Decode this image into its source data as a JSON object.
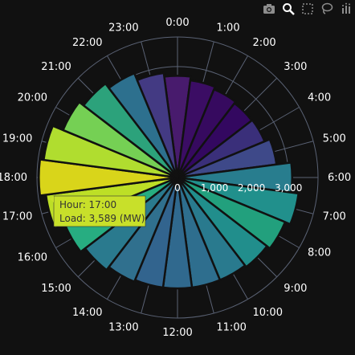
{
  "modebar": {
    "icons": [
      "camera-icon",
      "zoom-icon",
      "select-box-icon",
      "lasso-icon",
      "plotly-logo-icon"
    ]
  },
  "colors": {
    "background": "#111111",
    "grid": "#5a6274",
    "bar_edge": "#111111",
    "tooltip_bg": "#c8e02a"
  },
  "chart_data": {
    "type": "barpolar",
    "direction": "clockwise",
    "rotation_origin": "top",
    "categories": [
      "0:00",
      "1:00",
      "2:00",
      "3:00",
      "4:00",
      "5:00",
      "6:00",
      "7:00",
      "8:00",
      "9:00",
      "10:00",
      "11:00",
      "12:00",
      "13:00",
      "14:00",
      "15:00",
      "16:00",
      "17:00",
      "18:00",
      "19:00",
      "20:00",
      "21:00",
      "22:00",
      "23:00"
    ],
    "values": [
      2750,
      2650,
      2580,
      2530,
      2550,
      2700,
      3100,
      3300,
      3150,
      3050,
      3000,
      3000,
      3000,
      3000,
      3050,
      3150,
      3300,
      3589,
      3750,
      3650,
      3350,
      3200,
      3050,
      2850
    ],
    "colors": [
      "#481b6d",
      "#3b0d64",
      "#360a5f",
      "#330860",
      "#3a2f7a",
      "#3e4989",
      "#287d8e",
      "#21908c",
      "#22a07d",
      "#218e8c",
      "#297a8e",
      "#2e6e8e",
      "#30698e",
      "#32648e",
      "#30708e",
      "#2a7a8e",
      "#27ad81",
      "#bddf26",
      "#d9d51a",
      "#b0dd2f",
      "#75d054",
      "#2ca27b",
      "#2d708e",
      "#433a83"
    ],
    "radial_axis": {
      "range": [
        0,
        3800
      ],
      "tickvals": [
        0,
        1000,
        2000,
        3000
      ],
      "ticktext": [
        "0",
        "1,000",
        "2,000",
        "3,000"
      ],
      "angle": 90
    },
    "grid": true
  },
  "tooltip": {
    "line1": "Hour: 17:00",
    "line2": "Load: 3,589 (MW)"
  }
}
